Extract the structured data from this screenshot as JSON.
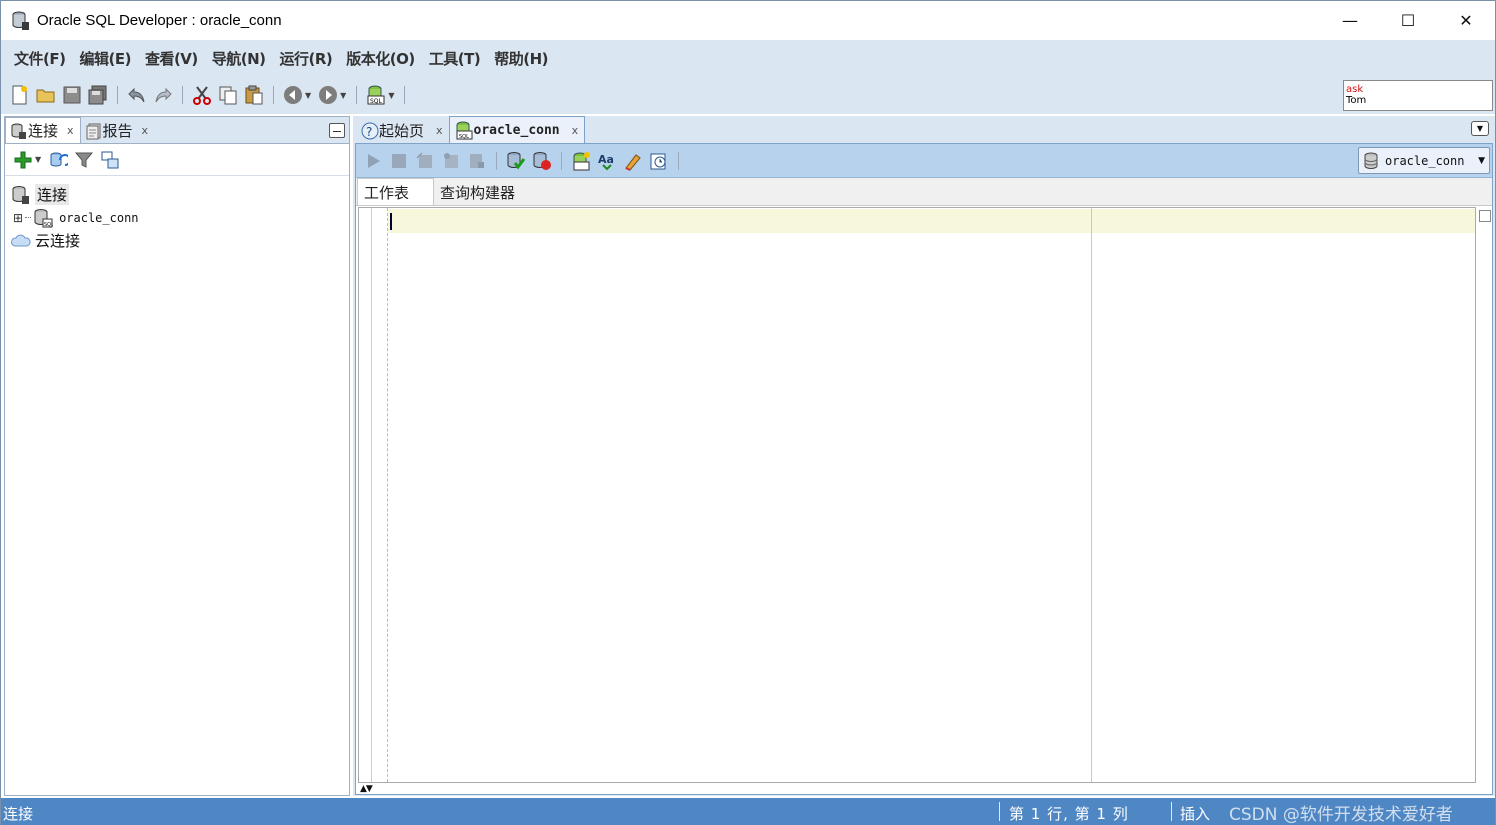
{
  "window": {
    "title": "Oracle SQL Developer : oracle_conn",
    "minimize_symbol": "—",
    "maximize_symbol": "☐",
    "close_symbol": "✕"
  },
  "menu": {
    "items": [
      "文件(F)",
      "编辑(E)",
      "查看(V)",
      "导航(N)",
      "运行(R)",
      "版本化(O)",
      "工具(T)",
      "帮助(H)"
    ]
  },
  "toolbar": {
    "icons": [
      "new-file-icon",
      "open-folder-icon",
      "save-icon",
      "save-all-icon",
      "undo-icon",
      "redo-icon",
      "cut-icon",
      "copy-icon",
      "paste-icon",
      "back-icon",
      "forward-icon",
      "sql-worksheet-icon"
    ],
    "memory_monitor": {
      "line1": "ask",
      "line2": "Tom"
    }
  },
  "left_panel": {
    "tabs": [
      {
        "label": "连接",
        "close": "x"
      },
      {
        "label": "报告",
        "close": "x"
      }
    ],
    "tree": {
      "root": "连接",
      "connection": "oracle_conn",
      "expander": "⊞",
      "cloud": "云连接"
    }
  },
  "editor_area": {
    "tabs": [
      {
        "label": "起始页",
        "close": "x"
      },
      {
        "label": "oracle_conn",
        "close": "x"
      }
    ],
    "connection_selector": "oracle_conn",
    "subtabs": [
      "工作表",
      "查询构建器"
    ]
  },
  "status": {
    "left": "连接",
    "position": "第 1 行, 第 1 列",
    "mode": "插入",
    "watermark": "CSDN @软件开发技术爱好者"
  },
  "colors": {
    "chrome": "#dbe6f3",
    "editor_toolbar": "#b7d2ec",
    "status_bar": "#4f87c4",
    "current_line": "#f7f7dc"
  }
}
